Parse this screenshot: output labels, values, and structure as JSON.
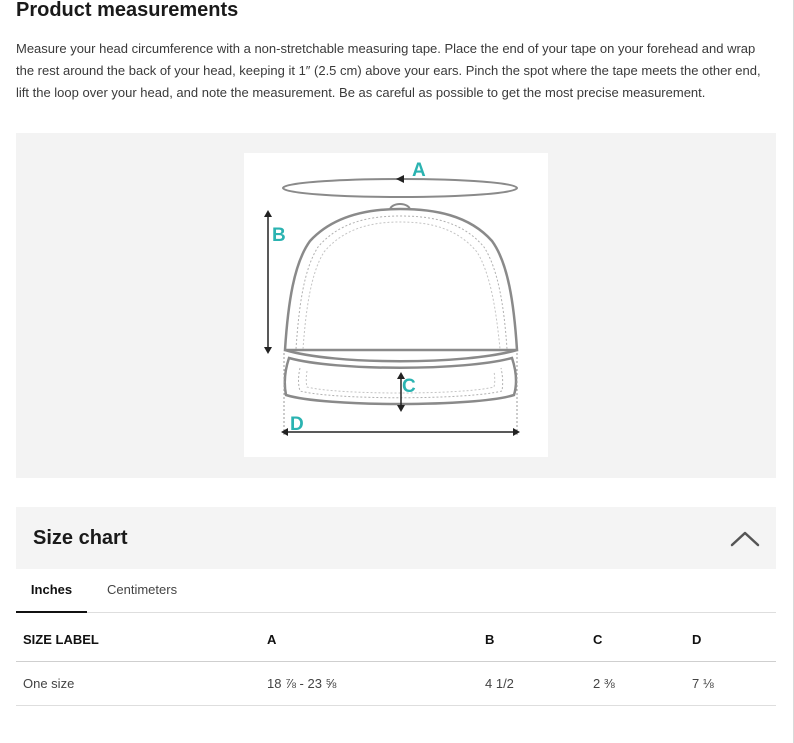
{
  "page": {
    "title": "Product measurements",
    "description": "Measure your head circumference with a non-stretchable measuring tape. Place the end of your  tape on your forehead and wrap the rest around the back of your head, keeping it 1″ (2.5 cm) above your ears. Pinch the spot where the tape meets the other end, lift the loop over your head, and note the measurement. Be as careful as possible to get the most precise measurement."
  },
  "diagram": {
    "labels": {
      "a": "A",
      "b": "B",
      "c": "C",
      "d": "D"
    },
    "accent_color": "#2bb3b1",
    "line_color": "#8a8a8a"
  },
  "size_chart": {
    "title": "Size chart",
    "collapse_icon": "chevron-up-icon",
    "tabs": [
      {
        "label": "Inches",
        "active": true
      },
      {
        "label": "Centimeters",
        "active": false
      }
    ],
    "columns": [
      "SIZE LABEL",
      "A",
      "B",
      "C",
      "D"
    ],
    "rows": [
      [
        "One size",
        "18 ⅞ - 23 ⅝",
        "4 1/2",
        "2 ⅜",
        "7 ⅛"
      ]
    ]
  }
}
